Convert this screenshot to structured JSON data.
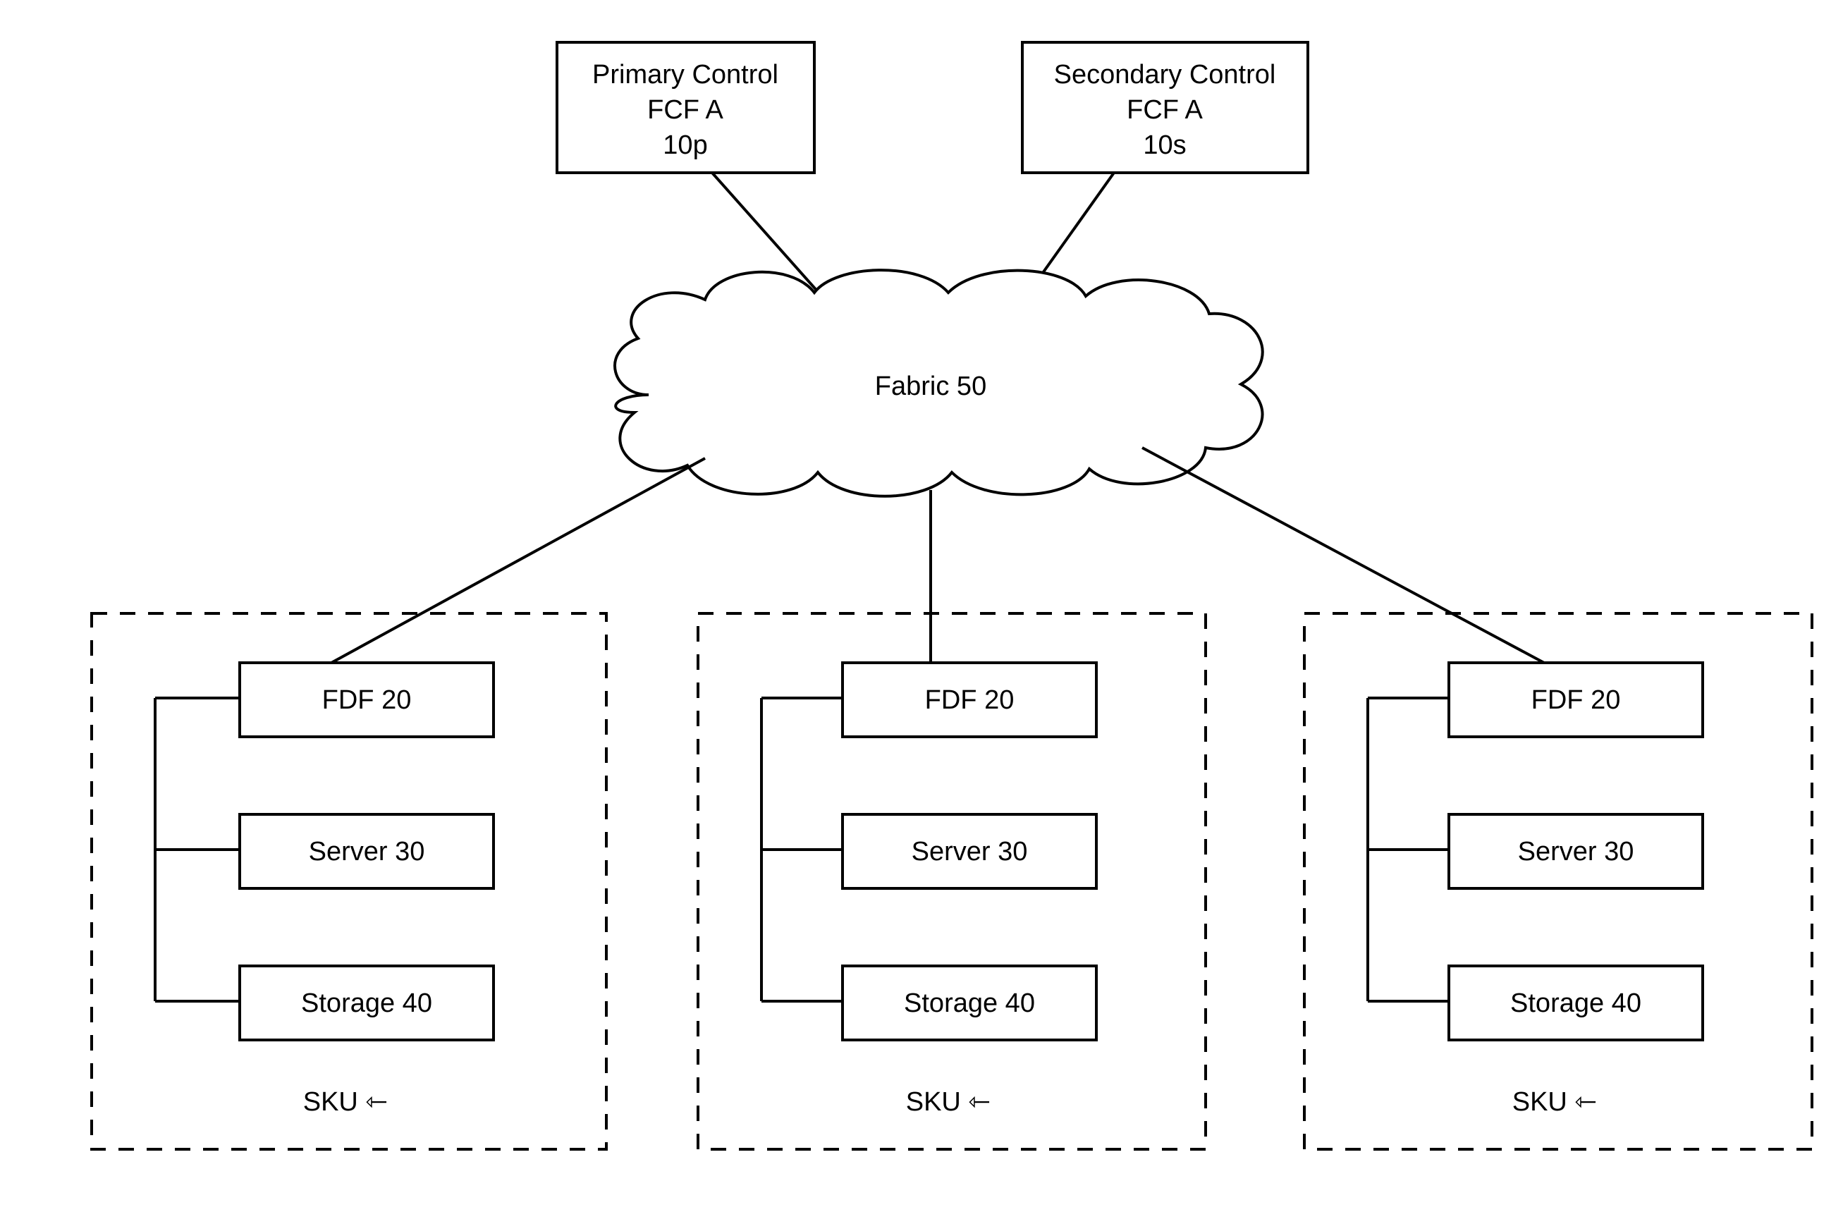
{
  "top": {
    "primary": {
      "line1": "Primary Control",
      "line2": "FCF A",
      "line3": "10p"
    },
    "secondary": {
      "line1": "Secondary Control",
      "line2": "FCF A",
      "line3": "10s"
    }
  },
  "cloud": {
    "label": "Fabric 50"
  },
  "sku_units": [
    {
      "fdf": "FDF 20",
      "server": "Server 30",
      "storage": "Storage 40",
      "sku": "SKU  ⇽"
    },
    {
      "fdf": "FDF 20",
      "server": "Server 30",
      "storage": "Storage 40",
      "sku": "SKU  ⇽"
    },
    {
      "fdf": "FDF 20",
      "server": "Server 30",
      "storage": "Storage 40",
      "sku": "SKU  ⇽"
    }
  ]
}
